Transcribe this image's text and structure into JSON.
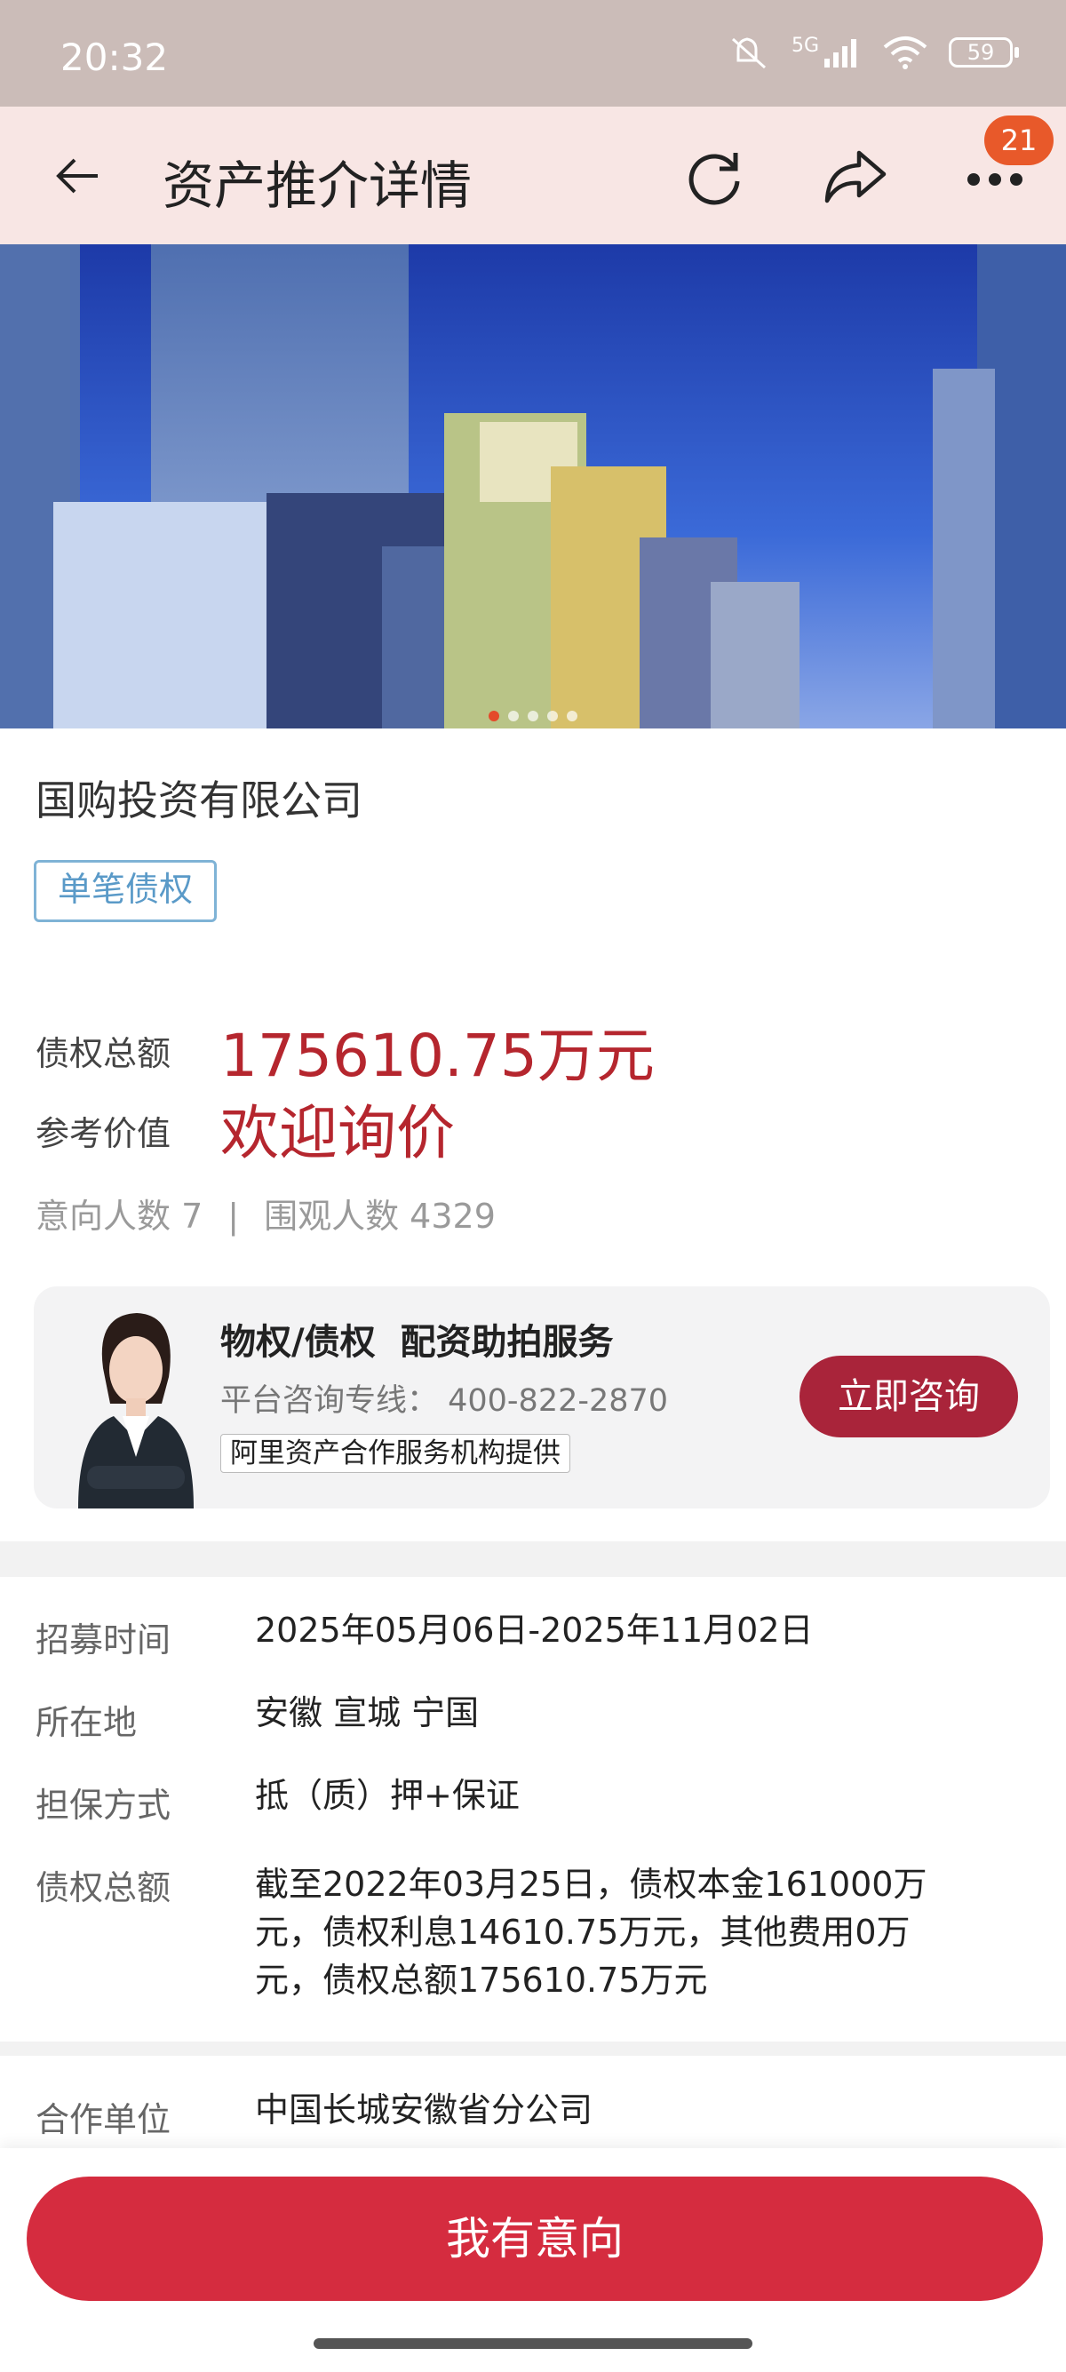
{
  "status_bar": {
    "time": "20:32",
    "network": "5G",
    "battery": "59"
  },
  "header": {
    "title": "资产推介详情",
    "badge_count": "21",
    "icons": [
      "back-arrow-icon",
      "refresh-icon",
      "share-icon",
      "more-icon"
    ]
  },
  "carousel": {
    "slide_count": 5,
    "active_index": 0
  },
  "asset": {
    "company": "国购投资有限公司",
    "tag": "单笔债权",
    "total_label": "债权总额",
    "total_value": "175610.75万元",
    "ref_label": "参考价值",
    "ref_value": "欢迎询价",
    "intent": "意向人数 7",
    "separator": "|",
    "views": "围观人数 4329"
  },
  "consult": {
    "title": "物权/债权  配资助拍服务",
    "hotline": "平台咨询专线： 400-822-2870",
    "provider": "阿里资产合作服务机构提供",
    "button": "立即咨询"
  },
  "details": [
    {
      "label": "招募时间",
      "value": "2025年05月06日-2025年11月02日"
    },
    {
      "label": "所在地",
      "value": "安徽 宣城 宁国"
    },
    {
      "label": "担保方式",
      "value": "抵（质）押+保证"
    },
    {
      "label": "债权总额",
      "value": "截至2022年03月25日，债权本金161000万元，债权利息14610.75万元，其他费用0万元，债权总额175610.75万元"
    }
  ],
  "partner": {
    "label": "合作单位",
    "value": "中国长城安徽省分公司"
  },
  "footer": {
    "button": "我有意向"
  },
  "colors": {
    "accent_red": "#b5262e",
    "button_red": "#d52c3f",
    "consult_red": "#a9243a",
    "badge_orange": "#e8592a"
  }
}
